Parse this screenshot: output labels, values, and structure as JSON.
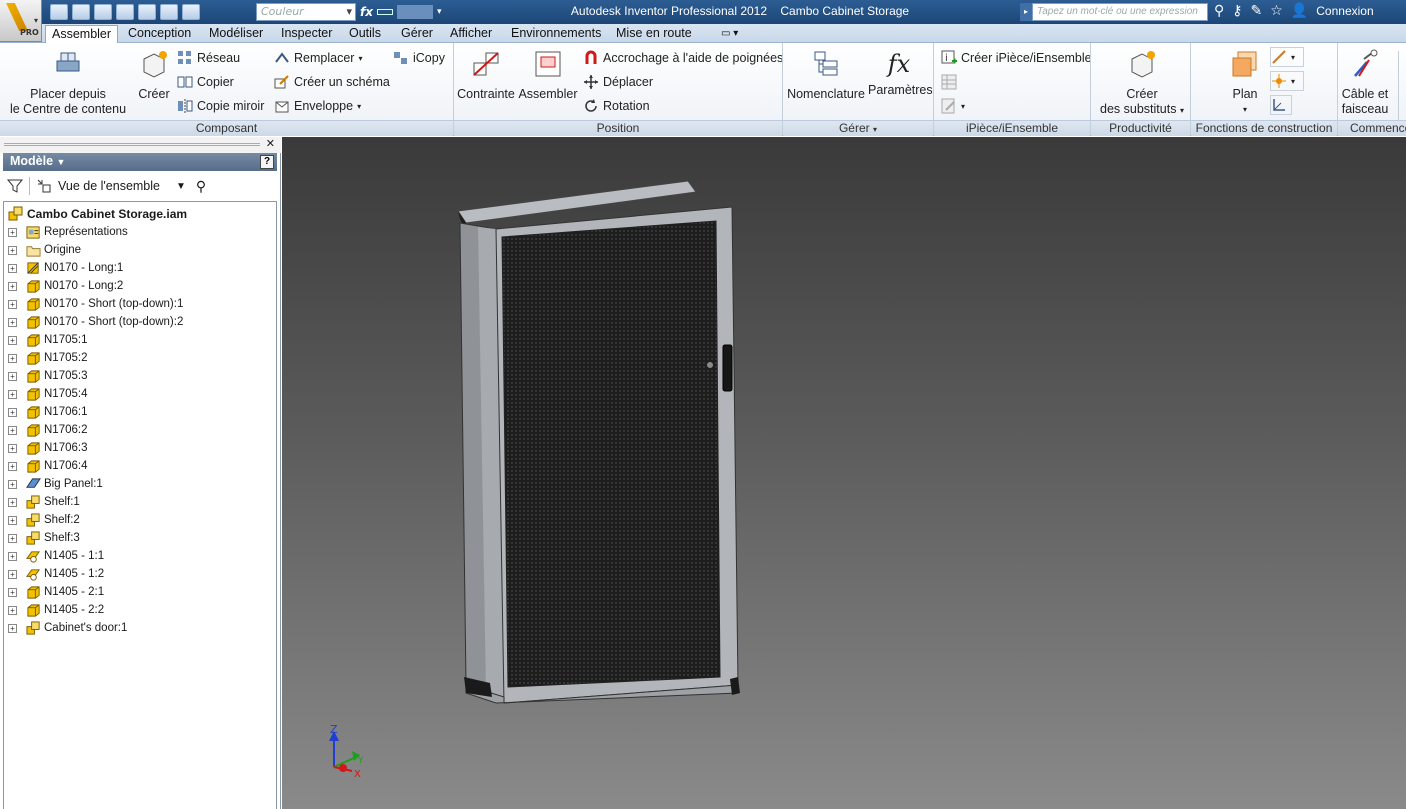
{
  "window": {
    "app_title": "Autodesk Inventor Professional 2012",
    "doc_title": "Cambo Cabinet Storage",
    "app_badge": "PRO"
  },
  "quick_access": {
    "color_placeholder": "Couleur",
    "search_placeholder": "Tapez un mot-clé ou une expression",
    "login_label": "Connexion"
  },
  "tabs": [
    {
      "label": "Assembler",
      "active": true
    },
    {
      "label": "Conception"
    },
    {
      "label": "Modéliser"
    },
    {
      "label": "Inspecter"
    },
    {
      "label": "Outils"
    },
    {
      "label": "Gérer"
    },
    {
      "label": "Afficher"
    },
    {
      "label": "Environnements"
    },
    {
      "label": "Mise en route"
    }
  ],
  "ribbon": {
    "composant": {
      "label": "Composant",
      "place_line1": "Placer depuis",
      "place_line2": "le Centre de contenu",
      "create": "Créer",
      "pattern": "Réseau",
      "copy": "Copier",
      "mirror": "Copie miroir",
      "replace": "Remplacer",
      "sketch": "Créer un schéma",
      "envelope": "Enveloppe",
      "icopy": "iCopy"
    },
    "position": {
      "label": "Position",
      "constraint": "Contrainte",
      "assemble": "Assembler",
      "grip": "Accrochage à l'aide de poignées",
      "move": "Déplacer",
      "rotate": "Rotation"
    },
    "gerer": {
      "label": "Gérer",
      "bom": "Nomenclature",
      "params": "Paramètres"
    },
    "ipiece": {
      "label": "iPièce/iEnsemble",
      "create": "Créer iPièce/iEnsemble"
    },
    "productivite": {
      "label": "Productivité",
      "line1": "Créer",
      "line2": "des substituts"
    },
    "fonctions": {
      "label": "Fonctions de construction",
      "plan": "Plan"
    },
    "commencer": {
      "label": "Commence",
      "line1": "Câble et",
      "line2": "faisceau"
    }
  },
  "browser": {
    "header": "Modèle",
    "view": "Vue de l'ensemble",
    "root": "Cambo Cabinet Storage.iam",
    "items": [
      {
        "label": "Représentations",
        "icon": "representations-icon"
      },
      {
        "label": "Origine",
        "icon": "folder-icon"
      },
      {
        "label": "N0170 - Long:1",
        "icon": "part-flexible-icon"
      },
      {
        "label": "N0170 - Long:2",
        "icon": "part-icon"
      },
      {
        "label": "N0170 - Short (top-down):1",
        "icon": "part-icon"
      },
      {
        "label": "N0170 - Short (top-down):2",
        "icon": "part-icon"
      },
      {
        "label": "N1705:1",
        "icon": "part-icon"
      },
      {
        "label": "N1705:2",
        "icon": "part-icon"
      },
      {
        "label": "N1705:3",
        "icon": "part-icon"
      },
      {
        "label": "N1705:4",
        "icon": "part-icon"
      },
      {
        "label": "N1706:1",
        "icon": "part-icon"
      },
      {
        "label": "N1706:2",
        "icon": "part-icon"
      },
      {
        "label": "N1706:3",
        "icon": "part-icon"
      },
      {
        "label": "N1706:4",
        "icon": "part-icon"
      },
      {
        "label": "Big Panel:1",
        "icon": "sheetmetal-icon"
      },
      {
        "label": "Shelf:1",
        "icon": "assembly-icon"
      },
      {
        "label": "Shelf:2",
        "icon": "assembly-icon"
      },
      {
        "label": "Shelf:3",
        "icon": "assembly-icon"
      },
      {
        "label": "N1405 - 1:1",
        "icon": "part-sheet-icon"
      },
      {
        "label": "N1405 - 1:2",
        "icon": "part-sheet-icon"
      },
      {
        "label": "N1405 - 2:1",
        "icon": "part-icon"
      },
      {
        "label": "N1405 - 2:2",
        "icon": "part-icon"
      },
      {
        "label": "Cabinet's door:1",
        "icon": "assembly-icon"
      }
    ]
  },
  "viewport": {
    "triad": {
      "z": "Z",
      "x": "X",
      "y": "Y"
    }
  },
  "colors": {
    "titlebar": "#1d4677",
    "part_yellow": "#f2c200",
    "viewport_top": "#3a3a3a",
    "viewport_bottom": "#8a8a8a"
  }
}
